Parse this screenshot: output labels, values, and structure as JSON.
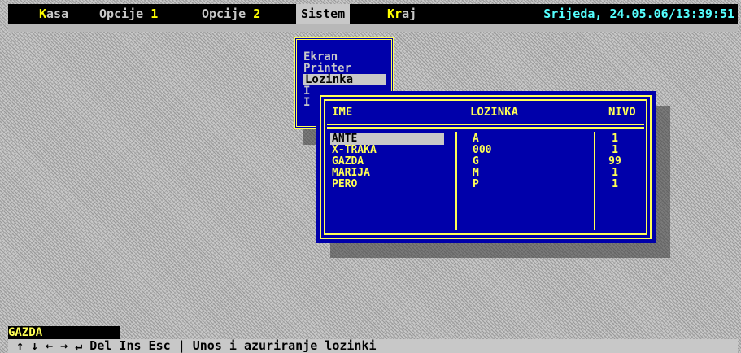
{
  "menubar": {
    "items": [
      {
        "hot": "K",
        "rest": "asa"
      },
      {
        "text": "Opcije ",
        "num": "1"
      },
      {
        "text": "Opcije ",
        "num": "2"
      },
      {
        "text": "Sistem"
      },
      {
        "hot": "K",
        "hot2": "r",
        "rest": "aj"
      }
    ],
    "datetime": "Srijeda, 24.05.06/13:39:51"
  },
  "submenu": {
    "items": [
      "Ekran",
      "Printer",
      "Lozinka",
      "I",
      "I"
    ]
  },
  "password_window": {
    "columns": [
      "IME",
      "LOZINKA",
      "NIVO"
    ],
    "rows": [
      {
        "ime": "ANTE",
        "lozinka": "A",
        "nivo": "1"
      },
      {
        "ime": "X-TRAKA",
        "lozinka": "000",
        "nivo": "1"
      },
      {
        "ime": "GAZDA",
        "lozinka": "G",
        "nivo": "99"
      },
      {
        "ime": "MARIJA",
        "lozinka": "M",
        "nivo": "1"
      },
      {
        "ime": "PERO",
        "lozinka": "P",
        "nivo": "1"
      }
    ]
  },
  "status": {
    "current_name": "GAZDA"
  },
  "helpbar": {
    "keys": "↑ ↓ ← → ↵ Del Ins Esc",
    "separator": "|",
    "description": "Unos i azuriranje lozinki"
  },
  "colors": {
    "window_bg": "#0000aa",
    "frame": "#ffff55",
    "menubar_bg": "#000000",
    "datetime": "#55ffff"
  }
}
